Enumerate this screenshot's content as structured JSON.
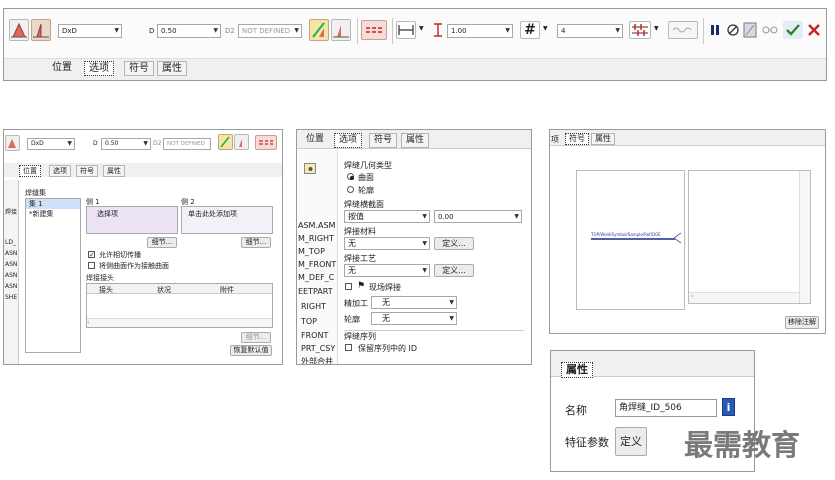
{
  "toolbar": {
    "profile_value": "DxD",
    "d_label": "D",
    "d_value": "0.50",
    "d2_label": "D2",
    "d2_value": "NOT DEFINED",
    "length_value": "1.00",
    "count_value": "4",
    "colors": {
      "accent_red": "#cc2222",
      "check_green": "#2a8a2a",
      "pause_navy": "#1a2a6a"
    }
  },
  "top_tabs": [
    "位置",
    "选项",
    "符号",
    "属性"
  ],
  "panel_a": {
    "profile_value": "DxD",
    "d_label": "D",
    "d_value": "0.50",
    "d2_label": "D2",
    "d2_value": "NOT DEFINED",
    "tabs": [
      "位置",
      "选项",
      "符号",
      "属性"
    ],
    "left_labels": [
      "焊接",
      "LD_",
      "ASN",
      "ASN",
      "ASN",
      "ASN",
      "SHE"
    ],
    "weld_set_label": "焊缝集",
    "set_items": [
      "集 1",
      "*新建集"
    ],
    "side1_label": "侧 1",
    "side1_value": "选择项",
    "side2_label": "侧 2",
    "side2_value": "单击此处添加项",
    "detail_label": "细节...",
    "check1": "允许相切传播",
    "check2": "将侧曲面作为接触曲面",
    "joint_label": "焊接接头",
    "col_headers": [
      "接头",
      "状况",
      "附件"
    ],
    "restore_label": "恢复默认值"
  },
  "panel_b": {
    "tabs": [
      "位置",
      "选项",
      "符号",
      "属性"
    ],
    "tree": [
      "ASM.ASM",
      "M_RIGHT",
      "M_TOP",
      "M_FRONT",
      "M_DEF_C",
      "EETPART",
      "RIGHT",
      "TOP",
      "FRONT",
      "PRT_CSY",
      "外部合并"
    ],
    "geom_type_label": "焊缝几何类型",
    "radio1": "曲面",
    "radio2": "轮廓",
    "cross_section_label": "焊缝横截面",
    "cross_value": "按值",
    "cross_num": "0.00",
    "material_label": "焊接材料",
    "material_value": "无",
    "define_label": "定义...",
    "process_label": "焊接工艺",
    "process_value": "无",
    "field_weld_label": "现场焊接",
    "finish_label": "精加工",
    "finish_value": "无",
    "contour_label": "轮廓",
    "contour_value": "无",
    "sequence_label": "焊缝序列",
    "keep_id_label": "保留序列中的 ID"
  },
  "panel_c": {
    "tabs": [
      "符号",
      "属性"
    ],
    "cut_tab": "项",
    "symbol_text": "TOP/Weld/Symbol/Sample/Ref/DOE",
    "remove_label": "移除注解"
  },
  "panel_d": {
    "tab": "属性",
    "name_label": "名称",
    "name_value": "角焊缝_ID_506",
    "param_label": "特征参数",
    "define_label": "定义"
  },
  "watermark": "最需教育"
}
